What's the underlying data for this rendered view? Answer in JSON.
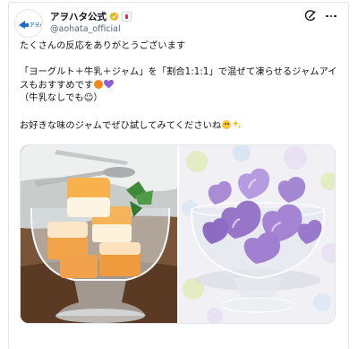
{
  "account": {
    "display_name": "アヲハタ公式",
    "handle": "@aohata_official",
    "logo_text": "アヲハタ"
  },
  "tweet": {
    "line1": "たくさんの反応をありがとうございます",
    "line2": "「ヨーグルト＋牛乳＋ジャム」を「割合1:1:1」で混ぜて凍らせるジャムアイ",
    "line3": "スもおすすめです",
    "line4": "（牛乳なしでも☺）",
    "line5": "お好きな味のジャムでぜひ試してみてくださいね"
  },
  "media": {
    "photos": [
      {
        "subject": "orange-jam-ice-cubes-in-glass"
      },
      {
        "subject": "purple-heart-jam-ice-in-glass"
      }
    ]
  },
  "icons": {
    "verified": "verified-badge-icon",
    "affiliate": "affiliate-badge-icon",
    "grok": "grok-icon",
    "more": "more-icon"
  },
  "colors": {
    "verified_gold": "#e2b719",
    "brand_blue": "#1d6fc4",
    "text_primary": "#0f1419",
    "text_secondary": "#536471",
    "border": "#e1e6ea"
  }
}
